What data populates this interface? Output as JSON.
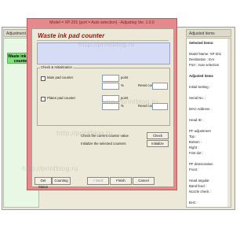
{
  "app": {
    "left_header": "Adjustment order",
    "right_header": "Adjusted items",
    "left_item": "Waste ink pad counter",
    "right_lines": [
      "Selected items:",
      "",
      "Model Name: XP-201",
      "Destination : EAI",
      "Port : Auto selection",
      "",
      "Adjusted items",
      "",
      "Initial Setting :",
      "",
      "Serial No. :",
      "",
      "MAC Address :",
      "",
      "Head ID :",
      "",
      "PF adjustment",
      "Top :",
      "Bottom :",
      "Right :",
      "First dot :",
      "",
      "PF deterioration",
      "Front :",
      "",
      "Head angular",
      "Band feed :",
      "Nozzle check :",
      "",
      "Bi-D :"
    ]
  },
  "dialog": {
    "title": "Model = XP-201 (port = Auto selection) - Adjusting Ver. 1.0.0",
    "heading": "Waste ink pad counter",
    "group_title": "Check & Initialization",
    "rows": [
      {
        "label": "Main pad counter",
        "unit_point": "point",
        "unit_pct": "%",
        "reset_label": "Reset count"
      },
      {
        "label": "Platen pad counter",
        "unit_point": "point",
        "unit_pct": "%",
        "reset_label": "Reset count"
      }
    ],
    "check_label": "Check the current counter value",
    "check_button": "Check",
    "init_label": "Initialize the selected counters",
    "init_button": "Initialize",
    "footer": {
      "get_status": "Get Status",
      "counting": "Counting",
      "back": "< Back",
      "finish": "Finish",
      "cancel": "Cancel"
    }
  },
  "watermark": "http://printblog.ru"
}
